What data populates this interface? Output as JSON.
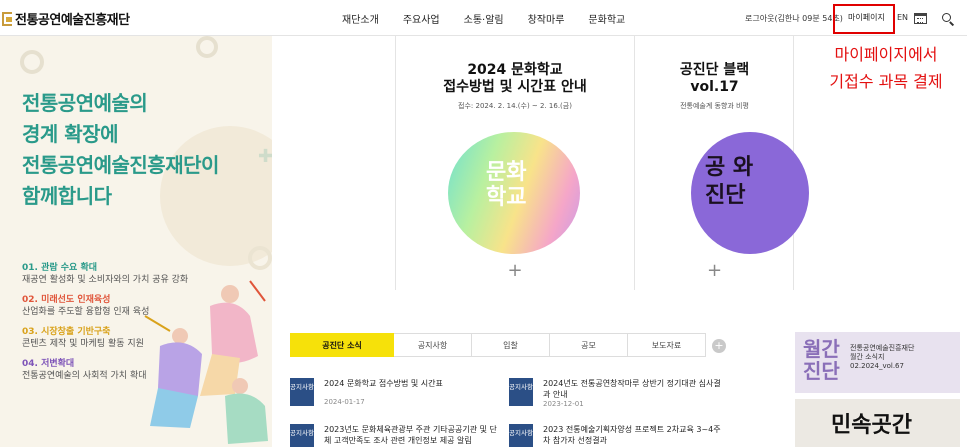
{
  "header": {
    "logo": "전통공연예술진흥재단",
    "nav": [
      "재단소개",
      "주요사업",
      "소통·알림",
      "창작마루",
      "문화학교"
    ],
    "session": "로그아웃(김한나 09분 54초)",
    "mypage": "마이페이지",
    "lang": "EN"
  },
  "annotation": {
    "line1": "마이페이지에서",
    "line2": "기접수 과목 결제"
  },
  "hero": {
    "title_lines": [
      "전통공연예술의",
      "경계 확장에",
      "전통공연예술진흥재단이",
      "함께합니다"
    ],
    "items": [
      {
        "title": "01. 관람 수요 확대",
        "desc": "재공연 활성화 및 소비자와의 가치 공유 강화",
        "color": "#2a9a8a"
      },
      {
        "title": "02. 미래선도 인재육성",
        "desc": "산업화를 주도할 융합형 인재 육성",
        "color": "#e0553a"
      },
      {
        "title": "03. 시장창출 기반구축",
        "desc": "콘텐츠 제작 및 마케팅 활동 지원",
        "color": "#d9a21b"
      },
      {
        "title": "04. 저변확대",
        "desc": "전통공연예술의 사회적 가치 확대",
        "color": "#7e54b8"
      }
    ]
  },
  "cards": [
    {
      "title_lines": [
        "2024 문화학교",
        "접수방법 및 시간표 안내"
      ],
      "sub": "접수: 2024. 2. 14.(수) ~ 2. 16.(금)",
      "image_text": [
        "문화",
        "학교"
      ]
    },
    {
      "title_lines": [
        "공진단 블랙",
        "vol.17"
      ],
      "sub": "전통예술계 동향과 비평",
      "image_text": [
        "공",
        "와",
        "진단"
      ]
    }
  ],
  "tabs": [
    "공진단 소식",
    "공지사항",
    "입찰",
    "공모",
    "보도자료"
  ],
  "news": [
    {
      "badge": "공지사항",
      "title": "2024 문화학교 접수방법 및 시간표",
      "date": "2024-01-17"
    },
    {
      "badge": "공지사항",
      "title": "2024년도 전통공연창작마루 상반기 정기대관 심사결과 안내",
      "date": "2023-12-01"
    },
    {
      "badge": "공지사항",
      "title": "2023년도 문화체육관광부 주관 기타공공기관 및 단체 고객만족도 조사 관련 개인정보 제공 알림",
      "date": ""
    },
    {
      "badge": "공지사항",
      "title": "2023 전통예술기획자양성 프로젝트 2차교육 3~4주차 참가자 선정결과",
      "date": ""
    }
  ],
  "banners": {
    "b1_big": [
      "월간",
      "진단"
    ],
    "b1_text": [
      "전통공연예술진흥재단",
      "월간 소식지",
      "02.2024_vol.67"
    ],
    "b2_text": "민속곳간"
  },
  "colors": {
    "accent_yellow": "#f6e10a",
    "teal": "#2a9a8a",
    "badge_blue": "#2b4f86",
    "annotation_red": "#e31010"
  }
}
